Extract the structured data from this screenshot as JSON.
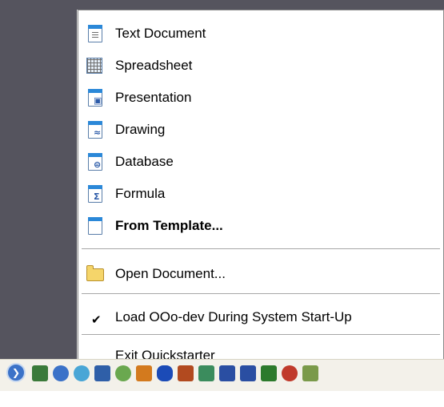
{
  "menu": {
    "items": [
      {
        "label": "Text Document",
        "icon": "text-document-icon"
      },
      {
        "label": "Spreadsheet",
        "icon": "spreadsheet-icon"
      },
      {
        "label": "Presentation",
        "icon": "presentation-icon"
      },
      {
        "label": "Drawing",
        "icon": "drawing-icon"
      },
      {
        "label": "Database",
        "icon": "database-icon"
      },
      {
        "label": "Formula",
        "icon": "formula-icon"
      },
      {
        "label": "From Template...",
        "icon": "template-icon"
      },
      {
        "label": "Open Document...",
        "icon": "folder-icon"
      },
      {
        "label": "Load OOo-dev During System Start-Up",
        "icon": "check-icon",
        "checked": true
      },
      {
        "label": "Exit Quickstarter"
      }
    ]
  },
  "colors": {
    "backdrop": "#55545e",
    "menu_bg": "#ffffff",
    "icon_blue": "#2b88d8",
    "tray_bg": "#f3f1ea"
  },
  "tray": {
    "icons": [
      "show-hidden-icons-chevron",
      "network-icon",
      "sync-icon",
      "update-icon",
      "zone-alarm-icon",
      "agent-icon",
      "calendar-icon",
      "bluetooth-icon",
      "volume-icon",
      "display-icon",
      "network-disconnected-icon",
      "network-disconnected-icon",
      "wireless-icon",
      "security-icon",
      "tool-icon"
    ]
  }
}
